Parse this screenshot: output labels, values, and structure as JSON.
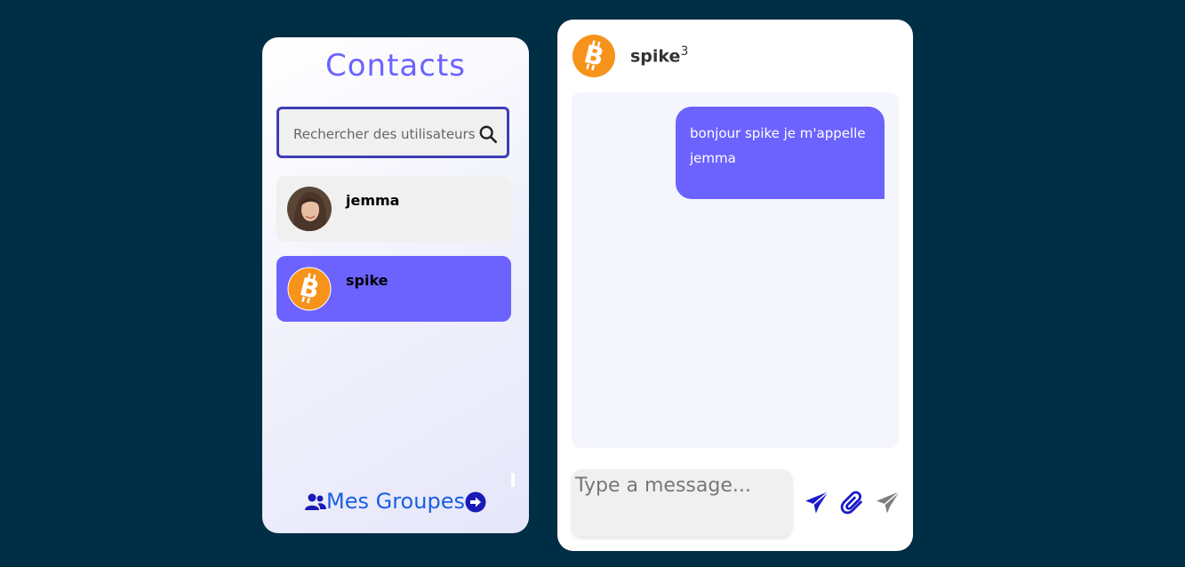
{
  "contacts": {
    "title": "Contacts",
    "search_placeholder": "Rechercher des utilisateurs",
    "items": [
      {
        "name": "jemma",
        "active": false
      },
      {
        "name": "spike",
        "active": true
      }
    ],
    "groups_link": "Mes Groupes"
  },
  "chat": {
    "header_name": "spike",
    "header_count": "3",
    "messages": [
      {
        "text": "bonjour spike je m'appelle jemma",
        "sender": "me"
      }
    ],
    "composer_placeholder": "Type a message..."
  },
  "colors": {
    "background": "#002e45",
    "accent": "#6c63ff",
    "link": "#1a5fe0",
    "bitcoin": "#f7931a"
  },
  "icons": [
    "search-icon",
    "users-icon",
    "arrow-right-circle-icon",
    "bitcoin-icon",
    "send-icon",
    "paperclip-icon",
    "send-alt-icon"
  ]
}
